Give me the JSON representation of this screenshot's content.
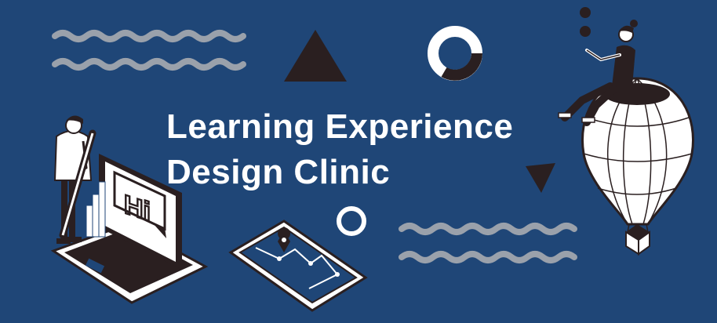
{
  "banner": {
    "title_line1": "Learning Experience",
    "title_line2": "Design Clinic",
    "laptop_screen_text": "Hi"
  },
  "colors": {
    "background": "#1f4677",
    "wave": "#9aa1ab",
    "dark": "#2a1f20",
    "white": "#ffffff",
    "title": "#ffffff"
  },
  "icons": [
    "wave-decoration",
    "triangle-shape",
    "ring-shape",
    "person-with-pencil",
    "laptop",
    "tablet-map",
    "map-pin-icon",
    "hot-air-balloon",
    "juggling-woman",
    "dot-shape"
  ]
}
